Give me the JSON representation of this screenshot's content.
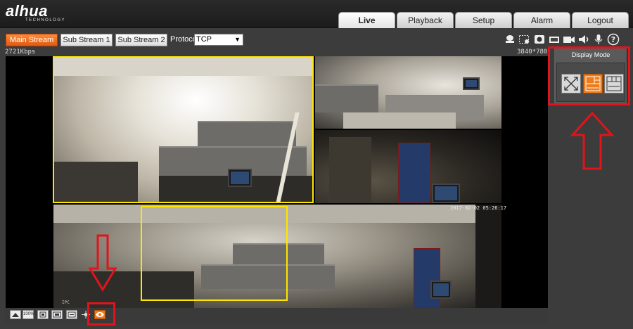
{
  "brand": {
    "name": "alhua",
    "subtitle": "TECHNOLOGY"
  },
  "nav": {
    "tabs": [
      {
        "label": "Live",
        "active": true
      },
      {
        "label": "Playback",
        "active": false
      },
      {
        "label": "Setup",
        "active": false
      },
      {
        "label": "Alarm",
        "active": false
      },
      {
        "label": "Logout",
        "active": false
      }
    ]
  },
  "toolbar": {
    "streams": [
      {
        "label": "Main Stream",
        "active": true
      },
      {
        "label": "Sub Stream 1",
        "active": false
      },
      {
        "label": "Sub Stream 2",
        "active": false
      }
    ],
    "protocol_label": "Protocol",
    "protocol_value": "TCP",
    "icons": [
      "ptz-icon",
      "region-zoom-icon",
      "record-icon",
      "snapshot-icon",
      "video-icon",
      "volume-icon",
      "microphone-icon",
      "help-icon"
    ]
  },
  "video": {
    "bitrate": "2721Kbps",
    "resolution": "3840*780",
    "timestamp": "2017-02-02 05:26:17",
    "overlay_label": "IPC"
  },
  "bottom_bar": {
    "icons": [
      "fullscreen-icon",
      "original-size-icon",
      "fit-window-icon",
      "aspect-ratio-icon",
      "zoom-icon",
      "ptz-control-icon",
      "fisheye-view-icon"
    ],
    "labels": [
      "",
      "100%",
      "",
      "",
      "",
      "",
      ""
    ]
  },
  "display_mode": {
    "title": "Display Mode",
    "options": [
      {
        "name": "fisheye-original",
        "active": false
      },
      {
        "name": "panoramic-split",
        "active": true
      },
      {
        "name": "grid",
        "active": false
      }
    ]
  },
  "colors": {
    "accent": "#f07a1a",
    "highlight_box": "#ffe600",
    "annotation": "#e1141b",
    "background": "#3c3c3c"
  }
}
